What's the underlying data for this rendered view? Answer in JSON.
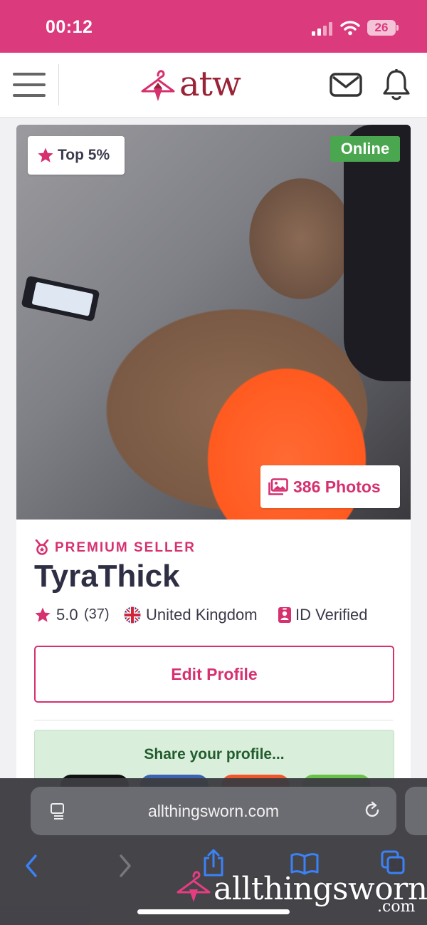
{
  "status_bar": {
    "time": "00:12",
    "battery": "26"
  },
  "header": {
    "logo": "atw"
  },
  "profile": {
    "badge_rank": "Top 5%",
    "online_status": "Online",
    "photos_count": "386 Photos",
    "tier": "PREMIUM SELLER",
    "username": "TyraThick",
    "rating": "5.0",
    "review_count": "(37)",
    "country": "United Kingdom",
    "verification": "ID Verified",
    "edit_button": "Edit Profile",
    "share_title": "Share your profile..."
  },
  "browser": {
    "url": "allthingsworn.com"
  },
  "watermark": {
    "text": "allthingsworn",
    "suffix": ".com"
  },
  "colors": {
    "brand_pink": "#db3a7c",
    "accent": "#d6306f",
    "logo_red": "#9a2338",
    "online_green": "#4aa64f",
    "share_bg": "#d9eedb"
  },
  "icons": [
    "signal-icon",
    "wifi-icon",
    "battery-icon",
    "menu-icon",
    "hanger-logo-icon",
    "mail-icon",
    "bell-icon",
    "star-icon",
    "images-icon",
    "medal-icon",
    "uk-flag-icon",
    "id-card-icon",
    "reader-icon",
    "reload-icon",
    "back-icon",
    "forward-icon",
    "share-icon",
    "bookmarks-icon",
    "tabs-icon"
  ]
}
